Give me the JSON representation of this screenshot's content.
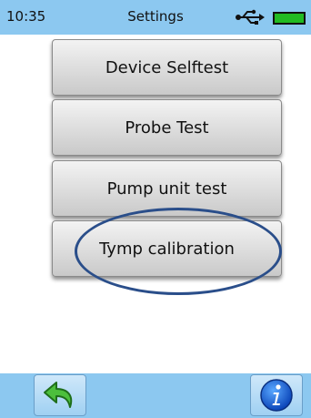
{
  "status_bar": {
    "time": "10:35",
    "title": "Settings",
    "usb_icon": "usb-icon",
    "battery_icon": "battery-icon",
    "battery_color": "#22bb22"
  },
  "menu": {
    "items": [
      {
        "label": "Device Selftest"
      },
      {
        "label": "Probe Test"
      },
      {
        "label": "Pump unit test"
      },
      {
        "label": "Tymp calibration"
      }
    ],
    "highlighted_item": "Tymp calibration"
  },
  "bottom_bar": {
    "back_icon": "back-arrow-icon",
    "info_icon": "info-icon"
  },
  "colors": {
    "bar_background": "#8cc8f0",
    "highlight_ellipse": "#2a4e8a"
  }
}
